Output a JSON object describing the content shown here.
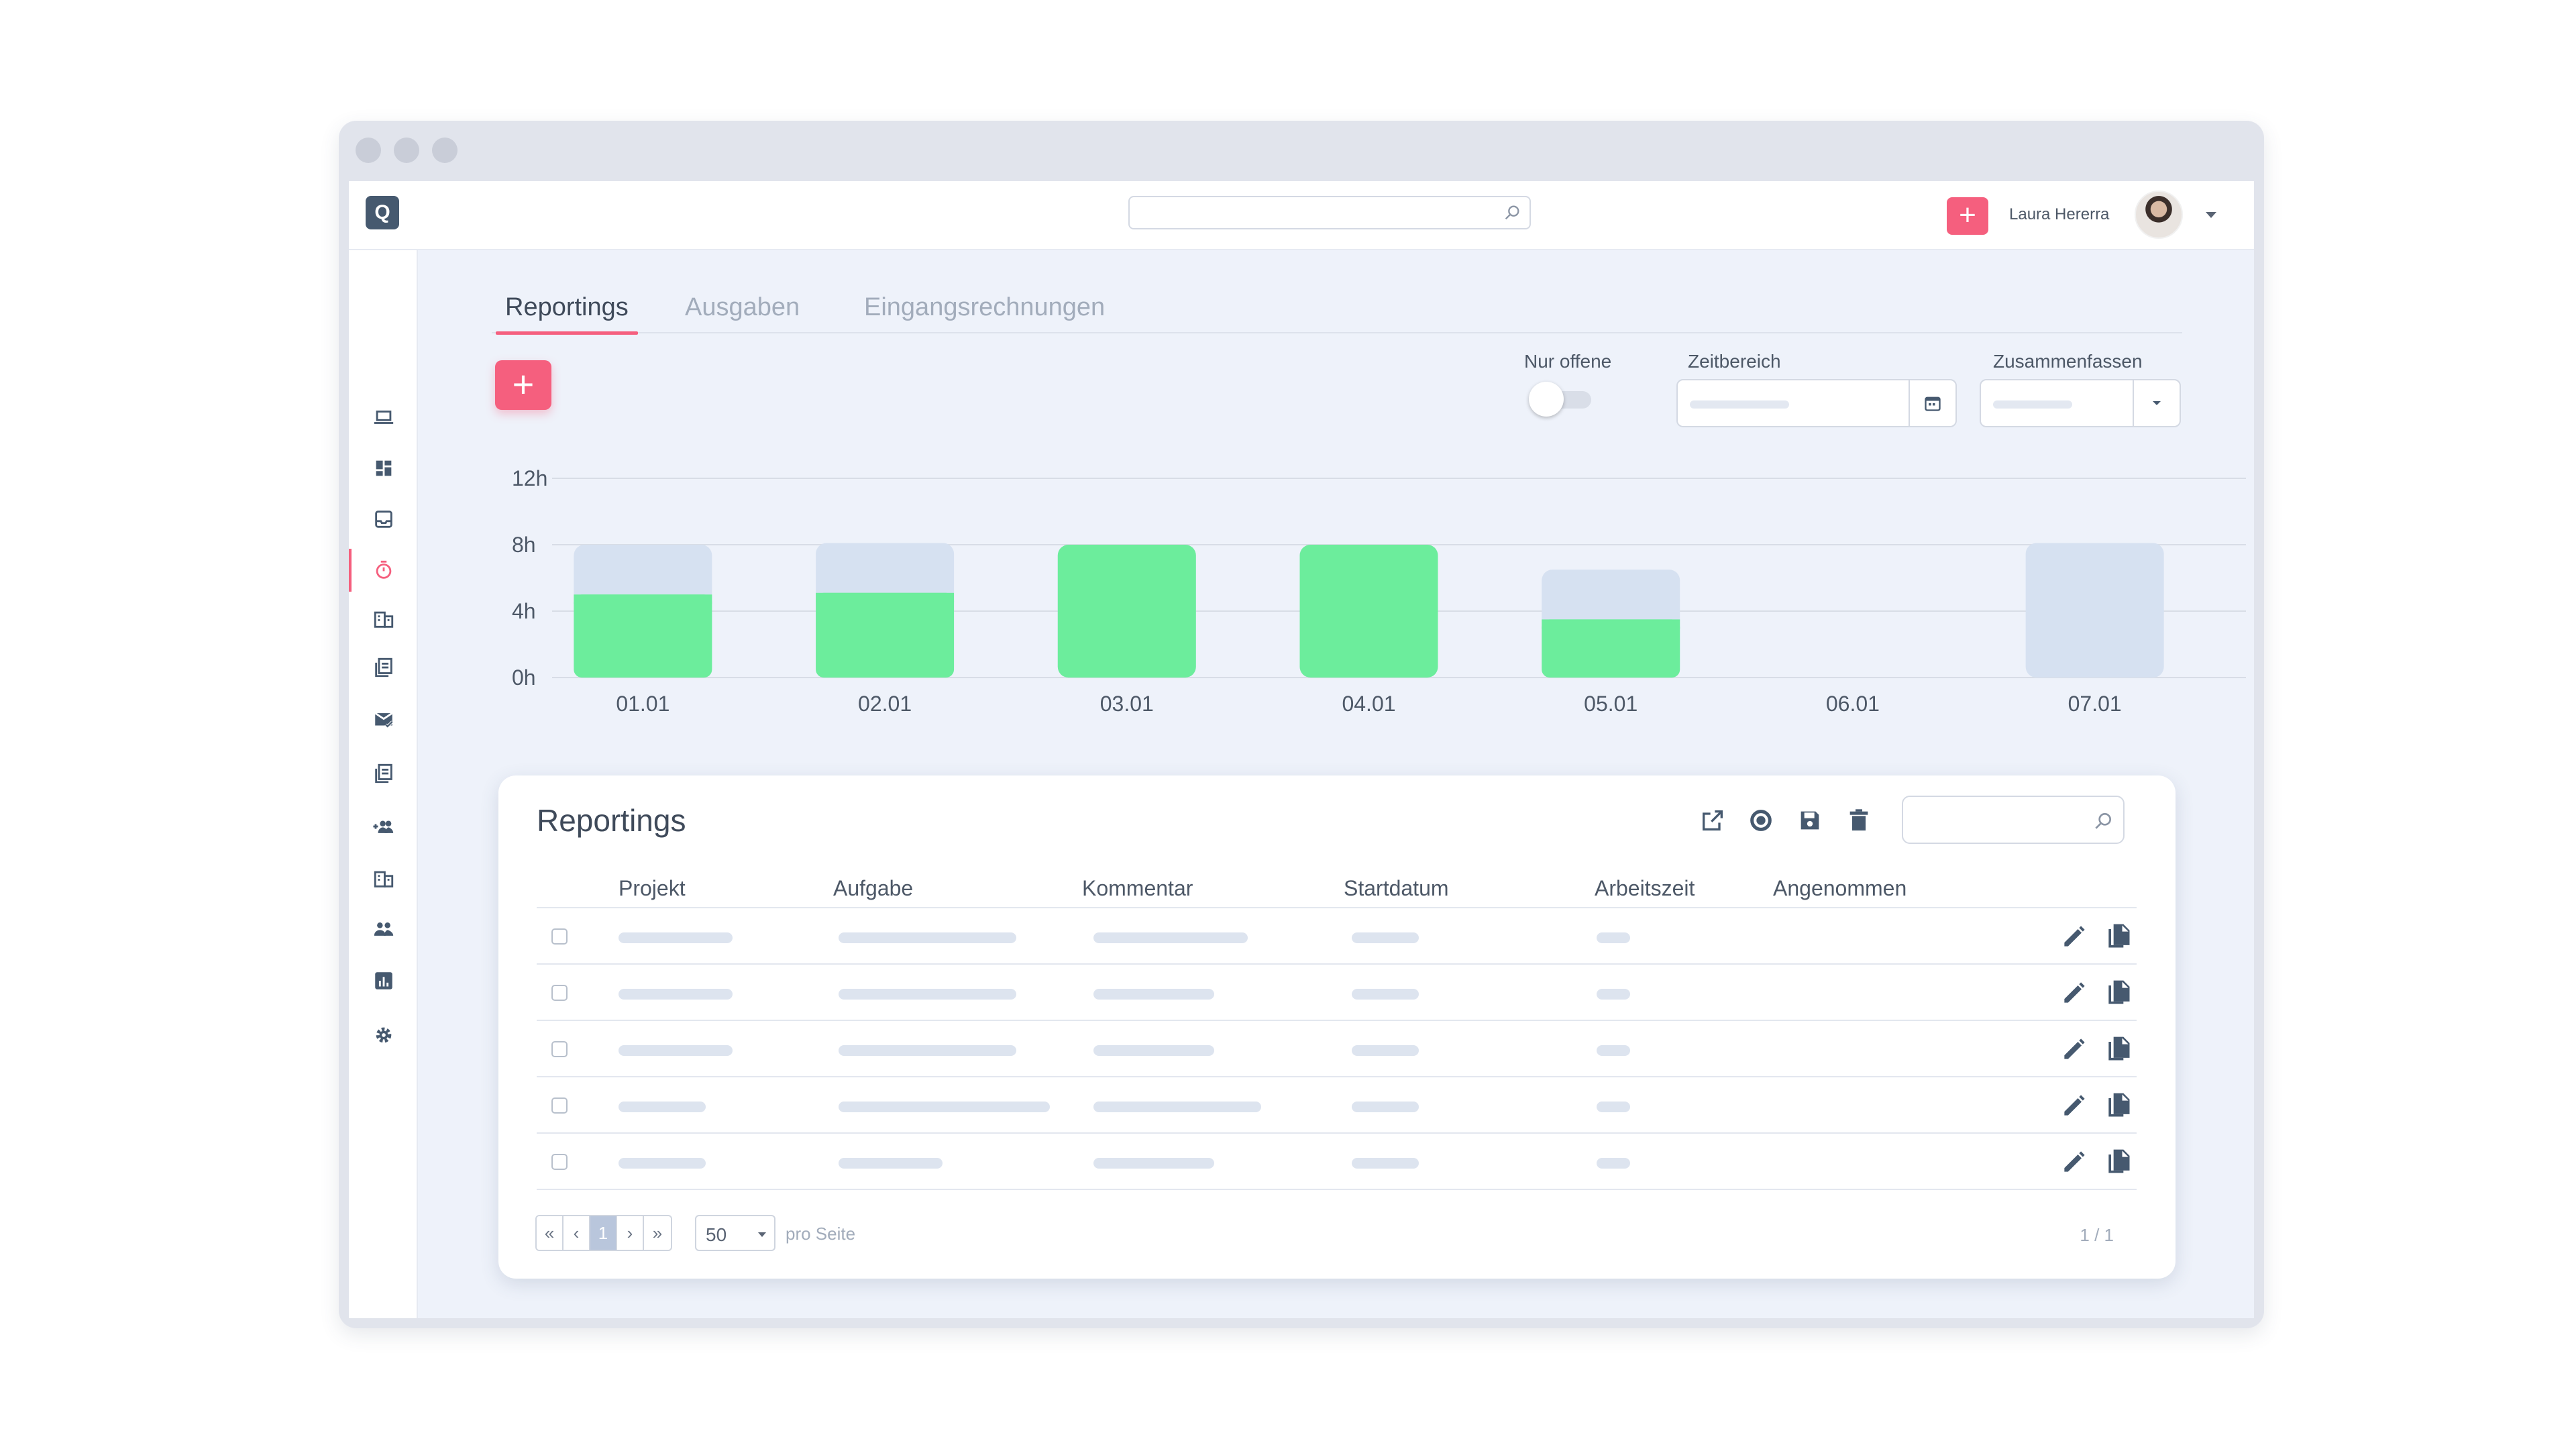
{
  "header": {
    "user_name": "Laura Hererra",
    "add_label": "+"
  },
  "tabs": [
    {
      "label": "Reportings",
      "active": true
    },
    {
      "label": "Ausgaben",
      "active": false
    },
    {
      "label": "Eingangsrechnungen",
      "active": false
    }
  ],
  "toolbar": {
    "add_label": "+"
  },
  "filters": {
    "open_only_label": "Nur offene",
    "open_only": false,
    "range_label": "Zeitbereich",
    "summarize_label": "Zusammenfassen"
  },
  "chart_data": {
    "type": "bar",
    "categories": [
      "01.01",
      "02.01",
      "03.01",
      "04.01",
      "05.01",
      "06.01",
      "07.01"
    ],
    "series": [
      {
        "values": [
          5,
          5.1,
          8,
          8,
          3.5,
          0,
          0
        ],
        "color": "#6ced9c"
      },
      {
        "values": [
          8,
          8.1,
          8,
          8,
          6.5,
          0,
          8.1
        ],
        "color": "#d6e1f1"
      }
    ],
    "yticks": [
      "0h",
      "4h",
      "8h",
      "12h"
    ],
    "ylim": [
      0,
      12
    ],
    "grid": true
  },
  "table": {
    "title": "Reportings",
    "columns": [
      "Projekt",
      "Aufgabe",
      "Kommentar",
      "Startdatum",
      "Arbeitszeit",
      "Angenommen"
    ],
    "row_count": 5
  },
  "pagination": {
    "first": "«",
    "prev": "‹",
    "current": "1",
    "next": "›",
    "last": "»",
    "per_page": "50",
    "per_page_label": "pro Seite",
    "page_info": "1 / 1"
  },
  "colors": {
    "accent": "#f55f7e",
    "bar_done": "#6ced9c",
    "bar_planned": "#d6e1f1"
  },
  "icons": {
    "sidebar": [
      "laptop-icon",
      "dashboard-icon",
      "inbox-icon",
      "stopwatch-icon",
      "building-icon",
      "documents-icon",
      "mail-check-icon",
      "documents-icon",
      "add-group-icon",
      "building-icon",
      "people-icon",
      "bar-chart-icon",
      "gear-icon"
    ],
    "table_tools": [
      "export-icon",
      "record-icon",
      "save-icon",
      "trash-icon"
    ],
    "row_actions": [
      "pencil-icon",
      "copy-icon"
    ]
  }
}
